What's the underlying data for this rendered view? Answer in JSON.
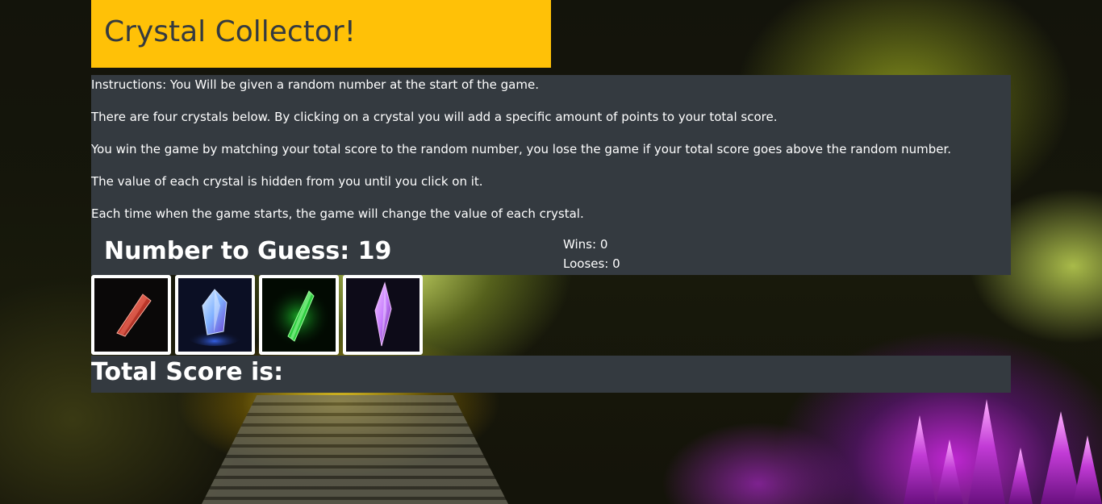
{
  "header": {
    "title": "Crystal Collector!"
  },
  "instructions": [
    "Instructions: You Will be given a random number at the start of the game.",
    "There are four crystals below. By clicking on a crystal you will add a specific amount of points to your total score.",
    "You win the game by matching your total score to the random number, you lose the game if your total score goes above the random number.",
    "The value of each crystal is hidden from you until you click on it.",
    "Each time when the game starts, the game will change the value of each crystal."
  ],
  "game": {
    "guess_text": "Number to Guess: 19",
    "wins_text": "Wins: 0",
    "losses_text": "Looses: 0",
    "total_text": "Total Score is:"
  },
  "crystals": [
    {
      "name": "red-crystal",
      "color": "#c0392b"
    },
    {
      "name": "blue-crystal",
      "color": "#6fa8ff"
    },
    {
      "name": "green-crystal",
      "color": "#2ecc40"
    },
    {
      "name": "purple-crystal",
      "color": "#c77dff"
    }
  ],
  "colors": {
    "header_bg": "#ffc107",
    "panel_bg": "#343a40",
    "header_text": "#343a40"
  }
}
